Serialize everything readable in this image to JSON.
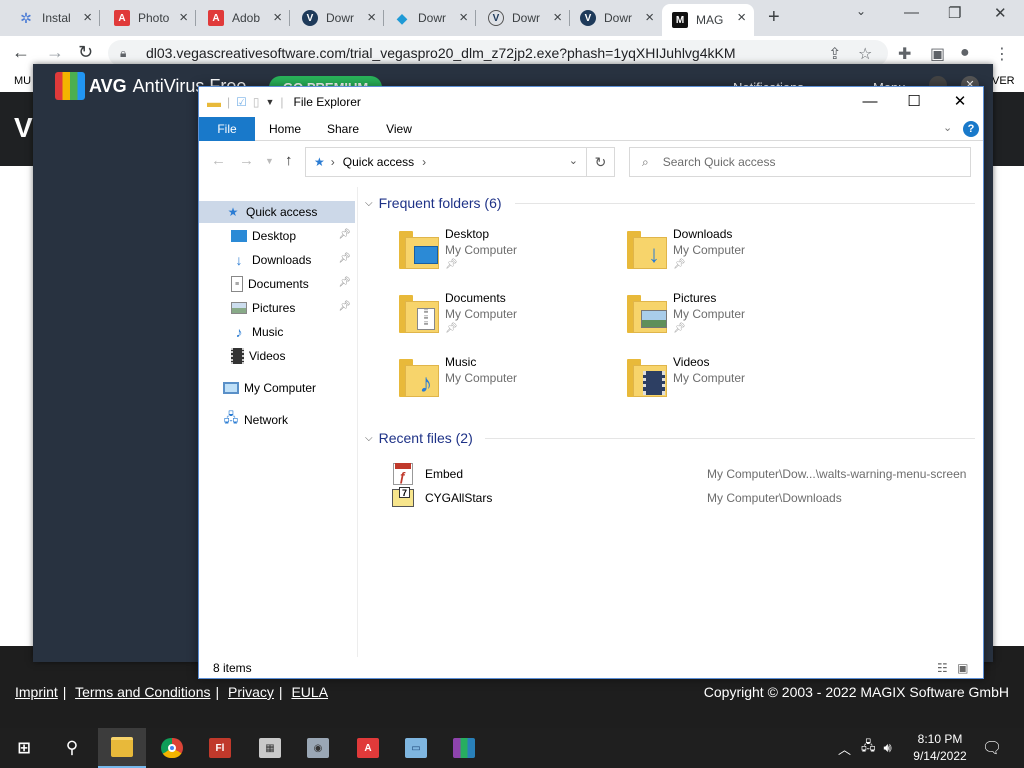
{
  "browser": {
    "tabs": [
      {
        "title": "Instal",
        "favicon": "gear-icon",
        "color": "#4a7bd6"
      },
      {
        "title": "Photo",
        "favicon": "adobe-icon",
        "color": "#e03a3a"
      },
      {
        "title": "Adob",
        "favicon": "adobe-icon",
        "color": "#e03a3a"
      },
      {
        "title": "Dowr",
        "favicon": "vegas-icon",
        "color": "#1e3a5a"
      },
      {
        "title": "Dowr",
        "favicon": "diamond-icon",
        "color": "#1f9ad6"
      },
      {
        "title": "Dowr",
        "favicon": "vegas-icon",
        "color": "#eee"
      },
      {
        "title": "Dowr",
        "favicon": "vegas-icon",
        "color": "#1e3a5a"
      },
      {
        "title": "MAG",
        "favicon": "magix-icon",
        "color": "#111"
      }
    ],
    "url": "dl03.vegascreativesoftware.com/trial_vegaspro20_dlm_z72jp2.exe?phash=1yqXHIJuhlvg4kKM"
  },
  "page": {
    "strip_left": "MU",
    "strip_right": "VER",
    "hero_letter": "V",
    "footer": {
      "links": [
        "Imprint",
        "Terms and Conditions",
        "Privacy",
        "EULA"
      ],
      "copyright": "Copyright © 2003 - 2022 MAGIX Software GmbH"
    }
  },
  "avg": {
    "brand": "AVG",
    "product": "AntiVirus Free",
    "premium_label": "GO PREMIUM",
    "notifications_label": "Notifications",
    "menu_label": "Menu"
  },
  "explorer": {
    "title": "File Explorer",
    "ribbon_tabs": [
      "File",
      "Home",
      "Share",
      "View"
    ],
    "address": "Quick access",
    "search_placeholder": "Search Quick access",
    "sidebar": [
      {
        "label": "Quick access",
        "icon": "star-icon",
        "pinned": false,
        "selected": true
      },
      {
        "label": "Desktop",
        "icon": "desktop-icon",
        "pinned": true
      },
      {
        "label": "Downloads",
        "icon": "download-icon",
        "pinned": true
      },
      {
        "label": "Documents",
        "icon": "document-icon",
        "pinned": true
      },
      {
        "label": "Pictures",
        "icon": "picture-icon",
        "pinned": true
      },
      {
        "label": "Music",
        "icon": "music-icon",
        "pinned": false
      },
      {
        "label": "Videos",
        "icon": "video-icon",
        "pinned": false
      },
      {
        "label": "My Computer",
        "icon": "computer-icon",
        "pinned": false
      },
      {
        "label": "Network",
        "icon": "network-icon",
        "pinned": false
      }
    ],
    "frequent_header": "Frequent folders (6)",
    "frequent": [
      {
        "name": "Desktop",
        "location": "My Computer",
        "pinned": true
      },
      {
        "name": "Downloads",
        "location": "My Computer",
        "pinned": true
      },
      {
        "name": "Documents",
        "location": "My Computer",
        "pinned": true
      },
      {
        "name": "Pictures",
        "location": "My Computer",
        "pinned": true
      },
      {
        "name": "Music",
        "location": "My Computer",
        "pinned": false
      },
      {
        "name": "Videos",
        "location": "My Computer",
        "pinned": false
      }
    ],
    "recent_header": "Recent files (2)",
    "recent": [
      {
        "name": "Embed",
        "path": "My Computer\\Dow...\\walts-warning-menu-screen"
      },
      {
        "name": "CYGAllStars",
        "path": "My Computer\\Downloads"
      }
    ],
    "status_count": "8 items"
  },
  "taskbar": {
    "apps": [
      "windows-start",
      "search",
      "file-explorer",
      "chrome",
      "flash",
      "calculator",
      "camera",
      "adobe",
      "remote-desktop",
      "winrar"
    ],
    "time": "8:10 PM",
    "date": "9/14/2022"
  }
}
